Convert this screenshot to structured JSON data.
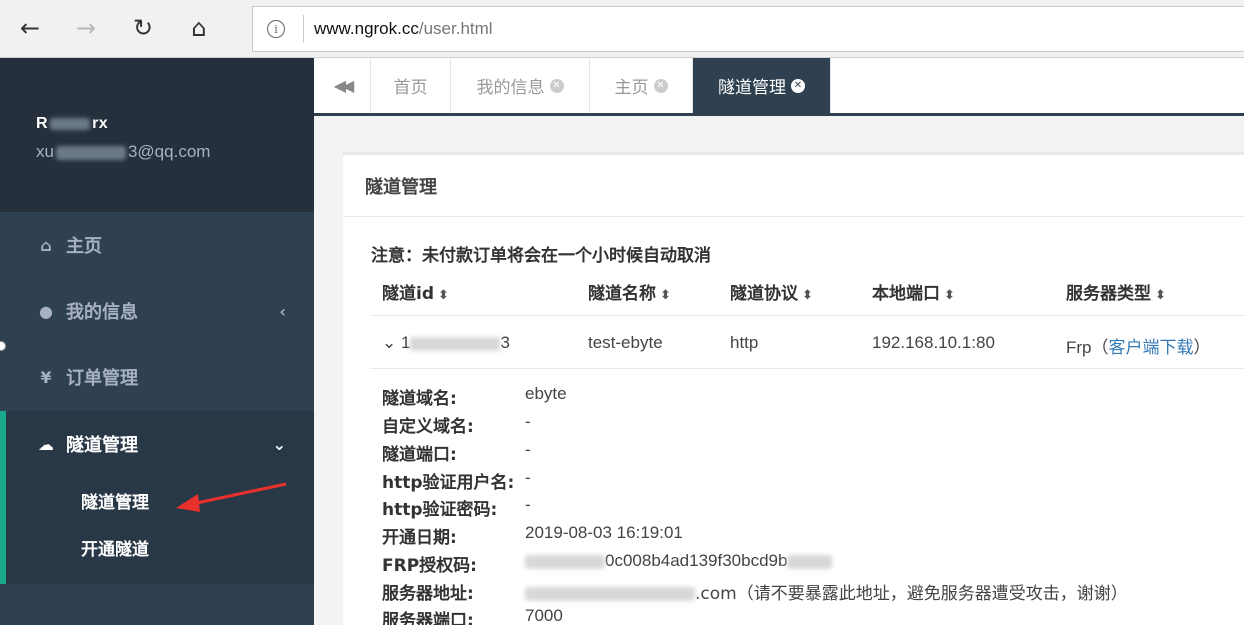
{
  "browser": {
    "back_glyph": "←",
    "forward_glyph": "→",
    "reload_glyph": "↻",
    "home_glyph": "⌂",
    "info_glyph": "i",
    "url_host": "www.ngrok.cc",
    "url_path": "/user.html"
  },
  "sidebar": {
    "profile_name": "R",
    "profile_name_tail": "rx",
    "profile_email_prefix": "xu",
    "profile_email_suffix": "3@qq.com",
    "items": [
      {
        "label": "主页",
        "icon": "home-icon",
        "glyph": "⌂"
      },
      {
        "label": "我的信息",
        "icon": "user-icon",
        "glyph": "●",
        "arrow": "‹"
      },
      {
        "label": "订单管理",
        "icon": "yen-icon",
        "glyph": "¥"
      },
      {
        "label": "隧道管理",
        "icon": "cloud-icon",
        "glyph": "☁",
        "arrow": "⌄"
      }
    ],
    "submenu": [
      {
        "label": "隧道管理"
      },
      {
        "label": "开通隧道"
      }
    ]
  },
  "tabs": {
    "back_glyph": "◀◀",
    "items": [
      {
        "label": "首页",
        "closable": false
      },
      {
        "label": "我的信息",
        "closable": true
      },
      {
        "label": "主页",
        "closable": true
      },
      {
        "label": "隧道管理",
        "closable": true,
        "active": true
      }
    ],
    "close_glyph": "✕"
  },
  "panel": {
    "title": "隧道管理",
    "notice": "注意：未付款订单将会在一个小时候自动取消",
    "sort_glyph": "⬍",
    "columns": [
      "隧道id",
      "隧道名称",
      "隧道协议",
      "本地端口",
      "服务器类型"
    ],
    "row": {
      "expand_glyph": "⌄",
      "id_prefix": "1",
      "id_suffix": "3",
      "name": "test-ebyte",
      "protocol": "http",
      "local_port": "192.168.10.1:80",
      "server_type": "Frp",
      "download_open": "（",
      "download_link": "客户端下载",
      "download_close": "）"
    },
    "details": [
      {
        "label": "隧道域名:",
        "value": "ebyte"
      },
      {
        "label": "自定义域名:",
        "value": "-"
      },
      {
        "label": "隧道端口:",
        "value": "-"
      },
      {
        "label": "http验证用户名:",
        "value": "-"
      },
      {
        "label": "http验证密码:",
        "value": "-"
      },
      {
        "label": "开通日期:",
        "value": "2019-08-03 16:19:01"
      },
      {
        "label": "FRP授权码:",
        "value": "0c008b4ad139f30bcd9b"
      },
      {
        "label": "服务器地址:",
        "value": ".com（请不要暴露此地址，避免服务器遭受攻击，谢谢）"
      },
      {
        "label": "服务器端口:",
        "value": "7000"
      }
    ]
  },
  "colors": {
    "sidebar_bg": "#2f4050",
    "accent": "#19aa8d",
    "link": "#337ab7",
    "arrow": "#e8312c"
  }
}
